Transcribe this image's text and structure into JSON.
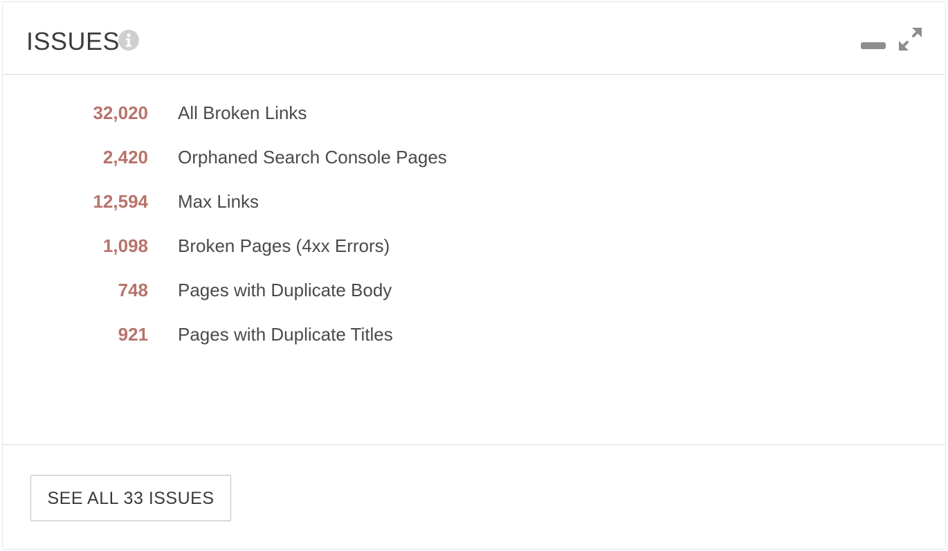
{
  "header": {
    "title": "ISSUES"
  },
  "issues": [
    {
      "count": "32,020",
      "label": "All Broken Links"
    },
    {
      "count": "2,420",
      "label": "Orphaned Search Console Pages"
    },
    {
      "count": "12,594",
      "label": "Max Links"
    },
    {
      "count": "1,098",
      "label": "Broken Pages (4xx Errors)"
    },
    {
      "count": "748",
      "label": "Pages with Duplicate Body"
    },
    {
      "count": "921",
      "label": "Pages with Duplicate Titles"
    }
  ],
  "footer": {
    "see_all_label": "SEE ALL 33 ISSUES"
  },
  "colors": {
    "count": "#b8736a",
    "label": "#4a4a4a",
    "icon": "#8e8e8e"
  },
  "icons": {
    "info": "info-icon",
    "minimize": "minimize-icon",
    "expand": "expand-icon"
  }
}
